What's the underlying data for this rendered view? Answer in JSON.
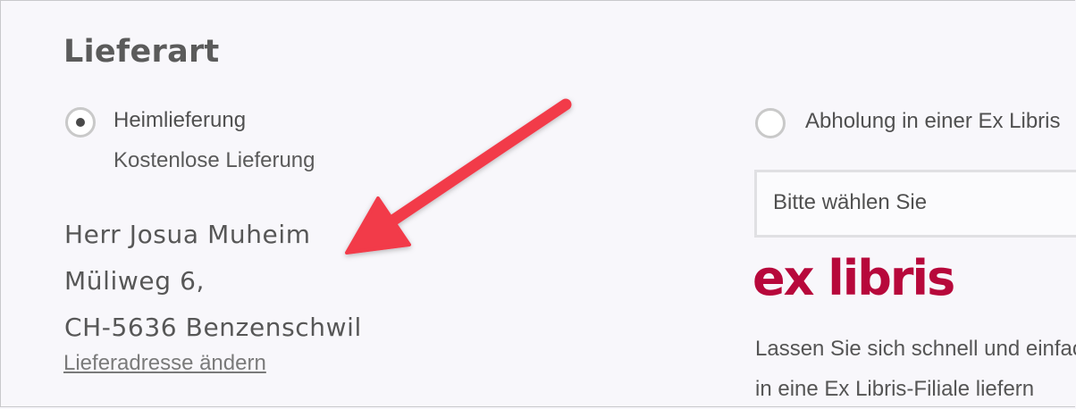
{
  "section": {
    "title": "Lieferart"
  },
  "home_delivery": {
    "label": "Heimlieferung",
    "sublabel": "Kostenlose Lieferung",
    "selected": true
  },
  "address": {
    "name": "Herr Josua Muheim",
    "street": "Müliweg 6,",
    "city": "CH-5636 Benzenschwil",
    "change_link": "Lieferadresse ändern"
  },
  "pickup": {
    "label": "Abholung in einer Ex Libris",
    "selected": false,
    "select_placeholder": "Bitte wählen Sie",
    "logo_text": "ex libris",
    "description": [
      "Lassen Sie sich schnell und einfach",
      "in eine Ex Libris-Filiale liefern"
    ]
  },
  "colors": {
    "arrow": "#f23a4a",
    "logo": "#b7083b"
  }
}
